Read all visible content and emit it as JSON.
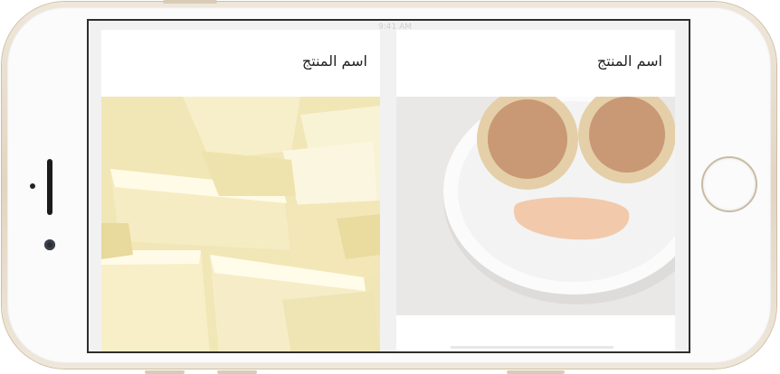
{
  "status_bar": {
    "time": "9:41 AM"
  },
  "products": [
    {
      "name": "اسم المنتج",
      "image": "white-chocolate-pieces-photo"
    },
    {
      "name": "اسم المنتج",
      "image": "plate-crackers-smiley-face-photo"
    }
  ],
  "colors": {
    "phone_frame": "#e2d5c1",
    "screen_background": "#f1f1f1",
    "card_background": "#ffffff",
    "text": "#222222"
  }
}
